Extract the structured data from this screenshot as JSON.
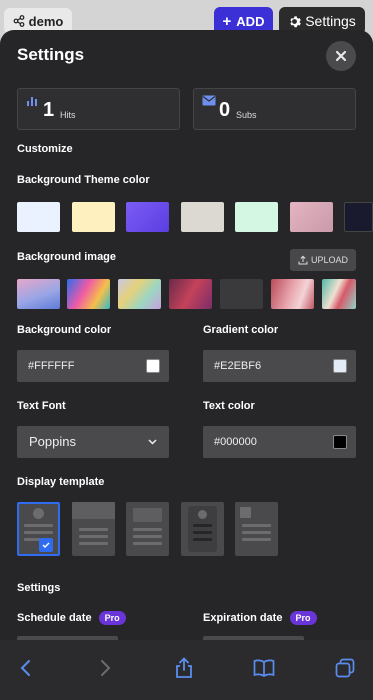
{
  "header": {
    "demo_label": "demo",
    "add_label": "ADD",
    "settings_label": "Settings"
  },
  "panel": {
    "title": "Settings",
    "stats": [
      {
        "value": "1",
        "label": "Hits",
        "icon": "bar-chart-icon"
      },
      {
        "value": "0",
        "label": "Subs",
        "icon": "mail-icon"
      }
    ],
    "customize_heading": "Customize",
    "bg_theme_label": "Background Theme color",
    "theme_colors": [
      "#eaf2ff",
      "#fff0c0",
      "#6e52f0",
      "#dcd9d3",
      "#d4f7e4",
      "#d9a6b6",
      "#1a1a2e"
    ],
    "bg_image_label": "Background image",
    "upload_label": "UPLOAD",
    "bg_color_label": "Background color",
    "bg_color_value": "#FFFFFF",
    "gradient_color_label": "Gradient color",
    "gradient_color_value": "#E2EBF6",
    "text_font_label": "Text Font",
    "text_font_value": "Poppins",
    "text_color_label": "Text color",
    "text_color_value": "#000000",
    "display_template_label": "Display template",
    "settings_heading": "Settings",
    "schedule_label": "Schedule date",
    "expiration_label": "Expiration date",
    "pro_badge": "Pro"
  },
  "colors": {
    "accent": "#3b2fd6",
    "pro": "#6a35d8",
    "panel_bg": "#262628",
    "selected_template": "#2f6cf0"
  }
}
